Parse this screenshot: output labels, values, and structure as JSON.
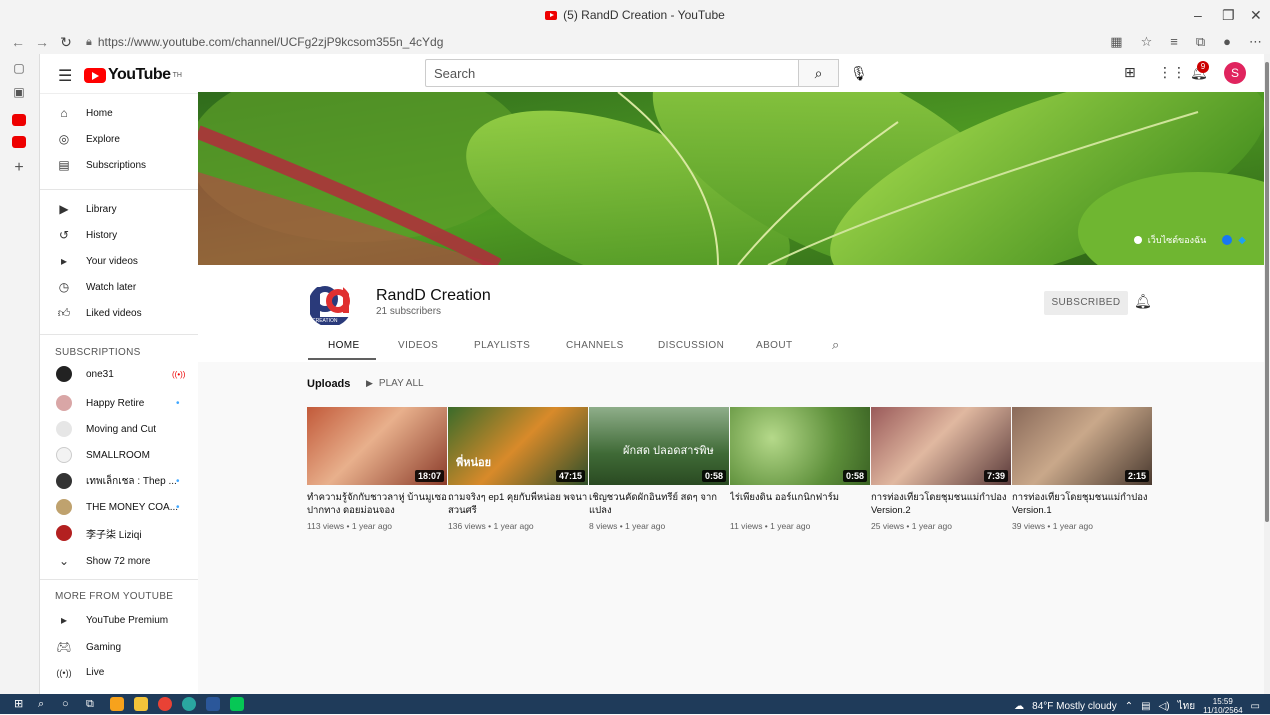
{
  "browser": {
    "tab_title": "(5) RandD Creation - YouTube",
    "url": "https://www.youtube.com/channel/UCFg2zjP9kcsom355n_4cYdg"
  },
  "header": {
    "logo_text": "YouTube",
    "logo_sup": "TH",
    "search_placeholder": "Search",
    "notification_count": "9",
    "avatar_letter": "S"
  },
  "sidebar": {
    "main": [
      {
        "label": "Home",
        "icon": "home-icon"
      },
      {
        "label": "Explore",
        "icon": "compass-icon"
      },
      {
        "label": "Subscriptions",
        "icon": "subscriptions-icon"
      }
    ],
    "library": [
      {
        "label": "Library",
        "icon": "library-icon"
      },
      {
        "label": "History",
        "icon": "history-icon"
      },
      {
        "label": "Your videos",
        "icon": "your-videos-icon"
      },
      {
        "label": "Watch later",
        "icon": "clock-icon"
      },
      {
        "label": "Liked videos",
        "icon": "thumbs-up-icon"
      }
    ],
    "subscriptions_heading": "SUBSCRIPTIONS",
    "subscriptions": [
      {
        "label": "one31",
        "badge": "live"
      },
      {
        "label": "Happy Retire",
        "badge": "dot"
      },
      {
        "label": "Moving and Cut",
        "badge": ""
      },
      {
        "label": "SMALLROOM",
        "badge": ""
      },
      {
        "label": "เทพเล็กเชล : Thep ...",
        "badge": "dot"
      },
      {
        "label": "THE MONEY COA...",
        "badge": "dot"
      },
      {
        "label": "李子柒 Liziqi",
        "badge": ""
      }
    ],
    "show_more": "Show 72 more",
    "more_heading": "MORE FROM YOUTUBE",
    "more": [
      {
        "label": "YouTube Premium",
        "icon": "premium-icon"
      },
      {
        "label": "Gaming",
        "icon": "gaming-icon"
      },
      {
        "label": "Live",
        "icon": "live-icon"
      }
    ]
  },
  "banner": {
    "link_text": "เว็บไซต์ของฉัน"
  },
  "channel": {
    "name": "RandD Creation",
    "subscribers": "21 subscribers",
    "logo_sub": "CREATION",
    "subscribe_label": "SUBSCRIBED",
    "tabs": [
      "HOME",
      "VIDEOS",
      "PLAYLISTS",
      "CHANNELS",
      "DISCUSSION",
      "ABOUT"
    ]
  },
  "uploads": {
    "title": "Uploads",
    "play_all": "PLAY ALL",
    "videos": [
      {
        "title": "ทำความรู้จักกับชาวลาหู่ บ้านมูเซอปากทาง ดอยม่อนจอง",
        "duration": "18:07",
        "meta": "113 views • 1 year ago",
        "thumb_text": ""
      },
      {
        "title": "ถามจริงๆ ep1 คุยกับพี่หน่อย พจนา สวนศรี",
        "duration": "47:15",
        "meta": "136 views • 1 year ago",
        "thumb_text": "พี่หน่อย"
      },
      {
        "title": "เชิญชวนคัดผักอินทรีย์ สดๆ จากแปลง",
        "duration": "0:58",
        "meta": "8 views • 1 year ago",
        "thumb_text": "ผักสด ปลอดสารพิษ"
      },
      {
        "title": "ไร่เพียงดิน ออร์แกนิกฟาร์ม",
        "duration": "0:58",
        "meta": "11 views • 1 year ago",
        "thumb_text": ""
      },
      {
        "title": "การท่องเที่ยวโดยชุมชนแม่กำปอง Version.2",
        "duration": "7:39",
        "meta": "25 views • 1 year ago",
        "thumb_text": ""
      },
      {
        "title": "การท่องเที่ยวโดยชุมชนแม่กำปอง Version.1",
        "duration": "2:15",
        "meta": "39 views • 1 year ago",
        "thumb_text": ""
      }
    ]
  },
  "taskbar": {
    "weather": "84°F  Mostly cloudy",
    "time": "15:59",
    "date": "11/10/2564",
    "lang": "ไทย"
  }
}
